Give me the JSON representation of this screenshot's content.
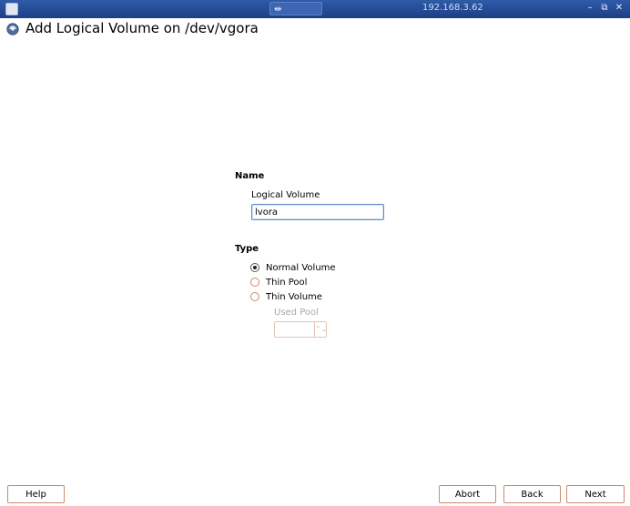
{
  "window": {
    "host": "192.168.3.62",
    "controls": {
      "minimize": "–",
      "restore": "⧉",
      "close": "✕"
    }
  },
  "header": {
    "title": "Add Logical Volume on /dev/vgora"
  },
  "form": {
    "name_section": "Name",
    "logical_volume_label": "Logical Volume",
    "logical_volume_value": "lvora",
    "type_section": "Type",
    "type_options": [
      {
        "label": "Normal Volume",
        "selected": true
      },
      {
        "label": "Thin Pool",
        "selected": false
      },
      {
        "label": "Thin Volume",
        "selected": false
      }
    ],
    "used_pool_label": "Used Pool",
    "used_pool_value": ""
  },
  "buttons": {
    "help": "Help",
    "abort": "Abort",
    "back": "Back",
    "next": "Next"
  },
  "colors": {
    "titlebar": "#2f5ba8",
    "button_border": "#c98a6e",
    "input_focus_border": "#5f8bd0"
  }
}
